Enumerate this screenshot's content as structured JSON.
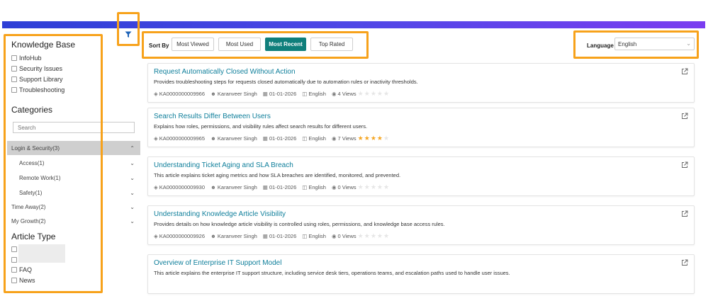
{
  "sidebar": {
    "knowledge_base_title": "Knowledge Base",
    "knowledge_base_items": [
      "InfoHub",
      "Security Issues",
      "Support Library",
      "Troubleshooting"
    ],
    "categories_title": "Categories",
    "search_placeholder": "Search",
    "categories": [
      {
        "label": "Login & Security(3)",
        "chevron": "up",
        "active": true,
        "sub": false
      },
      {
        "label": "Access(1)",
        "chevron": "down",
        "active": false,
        "sub": true
      },
      {
        "label": "Remote Work(1)",
        "chevron": "down",
        "active": false,
        "sub": true
      },
      {
        "label": "Safety(1)",
        "chevron": "down",
        "active": false,
        "sub": true
      },
      {
        "label": "Time Away(2)",
        "chevron": "down",
        "active": false,
        "sub": false
      },
      {
        "label": "My Growth(2)",
        "chevron": "down",
        "active": false,
        "sub": false
      }
    ],
    "article_type_title": "Article Type",
    "article_type_items": [
      "",
      "",
      "FAQ",
      "News"
    ]
  },
  "sort": {
    "label": "Sort By",
    "options": [
      "Most Viewed",
      "Most Used",
      "Most Recent",
      "Top Rated"
    ],
    "active_index": 2
  },
  "language": {
    "label": "Language",
    "selected": "English"
  },
  "articles": [
    {
      "title": "Request Automatically Closed Without Action",
      "description": "Provides troubleshooting steps for requests closed automatically due to automation rules or inactivity thresholds.",
      "id": "KA0000000009966",
      "author": "Karanveer Singh",
      "date": "01-01-2026",
      "language": "English",
      "views": "4 Views",
      "rating": 0
    },
    {
      "title": "Search Results Differ Between Users",
      "description": "Explains how roles, permissions, and visibility rules affect search results for different users.",
      "id": "KA0000000009965",
      "author": "Karanveer Singh",
      "date": "01-01-2026",
      "language": "English",
      "views": "7 Views",
      "rating": 4
    },
    {
      "title": "Understanding Ticket Aging and SLA Breach",
      "description": "This article explains ticket aging metrics and how SLA breaches are identified, monitored, and prevented.",
      "id": "KA0000000009930",
      "author": "Karanveer Singh",
      "date": "01-01-2026",
      "language": "English",
      "views": "0 Views",
      "rating": 0
    },
    {
      "title": "Understanding Knowledge Article Visibility",
      "description": "Provides details on how knowledge article visibility is controlled using roles, permissions, and knowledge base access rules.",
      "id": "KA0000000009926",
      "author": "Karanveer Singh",
      "date": "01-01-2026",
      "language": "English",
      "views": "0 Views",
      "rating": 0
    },
    {
      "title": "Overview of Enterprise IT Support Model",
      "description": "This article explains the enterprise IT support structure, including service desk tiers, operations teams, and escalation paths used to handle user issues.",
      "id": "",
      "author": "",
      "date": "",
      "language": "",
      "views": "",
      "rating": 0
    }
  ],
  "colors": {
    "accent": "#0f7f7b",
    "title_link": "#0f7f9b",
    "star": "#f5a623",
    "highlight": "#f7a21b"
  }
}
